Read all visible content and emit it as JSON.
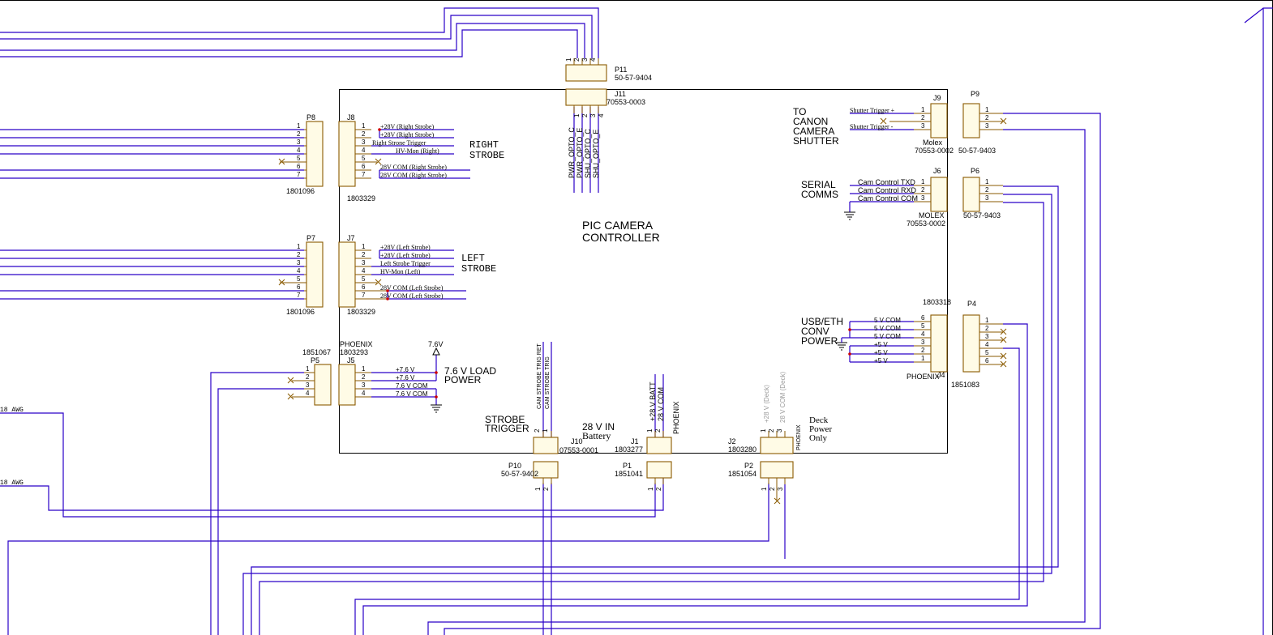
{
  "colors": {
    "wire": "#2a00c8",
    "component": "#8a5a00",
    "component_fill": "#fffbe6",
    "junction": "#d00000",
    "text": "#000000"
  },
  "title": {
    "line1": "PIC CAMERA",
    "line2": "CONTROLLER"
  },
  "wire_labels": {
    "awg_top": "18 AWG",
    "awg_bottom": "18 AWG"
  },
  "p11": {
    "ref": "P11",
    "part": "50-57-9404",
    "pins": [
      "1",
      "2",
      "3",
      "4"
    ]
  },
  "j11": {
    "ref": "J11",
    "part": "70553-0003",
    "pins": [
      "1",
      "2",
      "3",
      "4"
    ],
    "nets": [
      "PWR_OPTO_C",
      "PWR_OPTO_E",
      "SHU_OPTO_C",
      "SHU_OPTO_E"
    ]
  },
  "p8": {
    "ref": "P8",
    "part": "1801096",
    "pins": [
      "1",
      "2",
      "3",
      "4",
      "5",
      "6",
      "7"
    ]
  },
  "j8": {
    "ref": "J8",
    "part": "1803329",
    "pins": [
      "1",
      "2",
      "3",
      "4",
      "5",
      "6",
      "7"
    ],
    "nets": [
      "+28V (Right Strobe)",
      "+28V (Right Strobe)",
      "Right Strone Trigger",
      "HV-Mon (Right)",
      "",
      "28V COM (Right Strobe)",
      "28V COM (Right Strobe)"
    ],
    "group1": "RIGHT",
    "group2": "STROBE"
  },
  "p7": {
    "ref": "P7",
    "part": "1801096",
    "pins": [
      "1",
      "2",
      "3",
      "4",
      "5",
      "6",
      "7"
    ]
  },
  "j7": {
    "ref": "J7",
    "part": "1803329",
    "pins": [
      "1",
      "2",
      "3",
      "4",
      "5",
      "6",
      "7"
    ],
    "nets": [
      "+28V (Left Strobe)",
      "+28V (Left Strobe)",
      "Left Strobe Trigger",
      "HV-Mon (Left)",
      "",
      "28V COM (Left Strobe)",
      "28V COM (Left Strobe)"
    ],
    "group1": "LEFT",
    "group2": "STROBE"
  },
  "p5": {
    "ref": "P5",
    "part": "1851067",
    "pins": [
      "1",
      "2",
      "3",
      "4"
    ]
  },
  "j5": {
    "ref": "J5",
    "part1": "PHOENIX",
    "part2": "1803293",
    "pins": [
      "1",
      "2",
      "3",
      "4"
    ],
    "nets": [
      "+7.6 V",
      "+7.6 V",
      "7.6 V COM",
      "7.6 V COM"
    ],
    "power_label": "7.6V",
    "group1": "7.6 V LOAD",
    "group2": "POWER"
  },
  "j10": {
    "ref": "J10",
    "part": "07553-0001",
    "pins": [
      "2",
      "1"
    ],
    "nets": [
      "CAM STROBE TRIG RET",
      "CAM STROBE TRIG"
    ],
    "group1": "STROBE",
    "group2": "TRIGGER"
  },
  "p10": {
    "ref": "P10",
    "part": "50-57-9402",
    "pins": [
      "1",
      "2"
    ]
  },
  "j1": {
    "ref": "J1",
    "part": "1803277",
    "pins": [
      "1",
      "2"
    ],
    "nets": [
      "+28 V BATT",
      "28 V COM"
    ],
    "vendor": "PHOENIX",
    "group1": "28 V IN",
    "group2": "Battery"
  },
  "p1": {
    "ref": "P1",
    "part": "1851041",
    "pins": [
      "1",
      "2"
    ]
  },
  "j2": {
    "ref": "J2",
    "part": "1803280",
    "pins": [
      "1",
      "2",
      "3"
    ],
    "nets": [
      "+28 V (Deck)",
      "28 V COM (Deck)"
    ],
    "vendor": "PHOENIX",
    "group1": "Deck",
    "group2": "Power",
    "group3": "Only"
  },
  "p2": {
    "ref": "P2",
    "part": "1851054",
    "pins": [
      "1",
      "2",
      "3"
    ]
  },
  "j9": {
    "ref": "J9",
    "vendor": "Molex",
    "part": "70553-0002",
    "pins": [
      "1",
      "2",
      "3"
    ],
    "nets": [
      "Shutter Trigger +",
      "Shutter Trigger -"
    ],
    "group1": "TO",
    "group2": "CANON",
    "group3": "CAMERA",
    "group4": "SHUTTER"
  },
  "p9": {
    "ref": "P9",
    "part": "50-57-9403",
    "pins": [
      "1",
      "2",
      "3"
    ]
  },
  "j6": {
    "ref": "J6",
    "vendor": "MOLEX",
    "part": "70553-0002",
    "pins": [
      "1",
      "2",
      "3"
    ],
    "nets": [
      "Cam Control TXD",
      "Cam Control RXD",
      "Cam Control COM"
    ],
    "group1": "SERIAL",
    "group2": "COMMS"
  },
  "p6": {
    "ref": "P6",
    "part": "50-57-9403",
    "pins": [
      "1",
      "2",
      "3"
    ]
  },
  "j4": {
    "ref": "J4",
    "part1": "1803318",
    "vendor": "PHOENIX",
    "pins": [
      "6",
      "5",
      "4",
      "3",
      "2",
      "1"
    ],
    "nets": [
      "5 V COM",
      "5 V COM",
      "5 V COM",
      "+5 V",
      "+5 V",
      "+5 V"
    ],
    "group1": "USB/ETH",
    "group2": "CONV",
    "group3": "POWER"
  },
  "p4": {
    "ref": "P4",
    "part": "1851083",
    "pins": [
      "1",
      "2",
      "3",
      "4",
      "5",
      "6"
    ]
  }
}
